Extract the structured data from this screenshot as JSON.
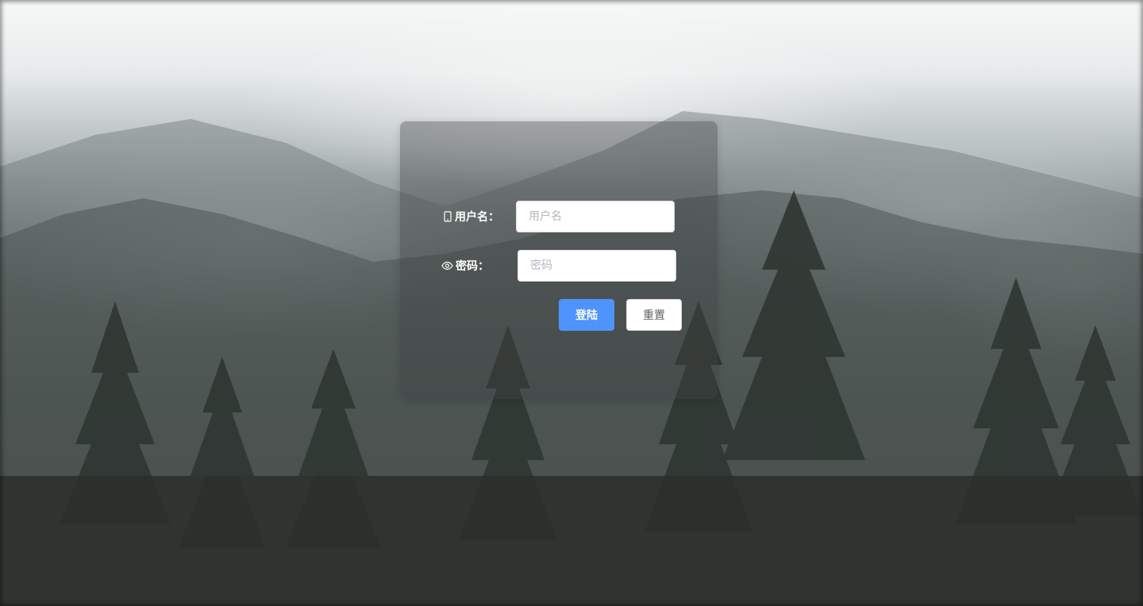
{
  "login_form": {
    "username": {
      "icon": "mobile-phone-icon",
      "label": "用户名：",
      "value": "",
      "placeholder": "用户名"
    },
    "password": {
      "icon": "eye-icon",
      "label": "密码：",
      "value": "",
      "placeholder": "密码"
    },
    "login_button": "登陆",
    "reset_button": "重置"
  },
  "colors": {
    "primary": "#4f94fe",
    "label_text": "#ffffff",
    "card_overlay": "rgba(60,64,64,0.38)"
  }
}
